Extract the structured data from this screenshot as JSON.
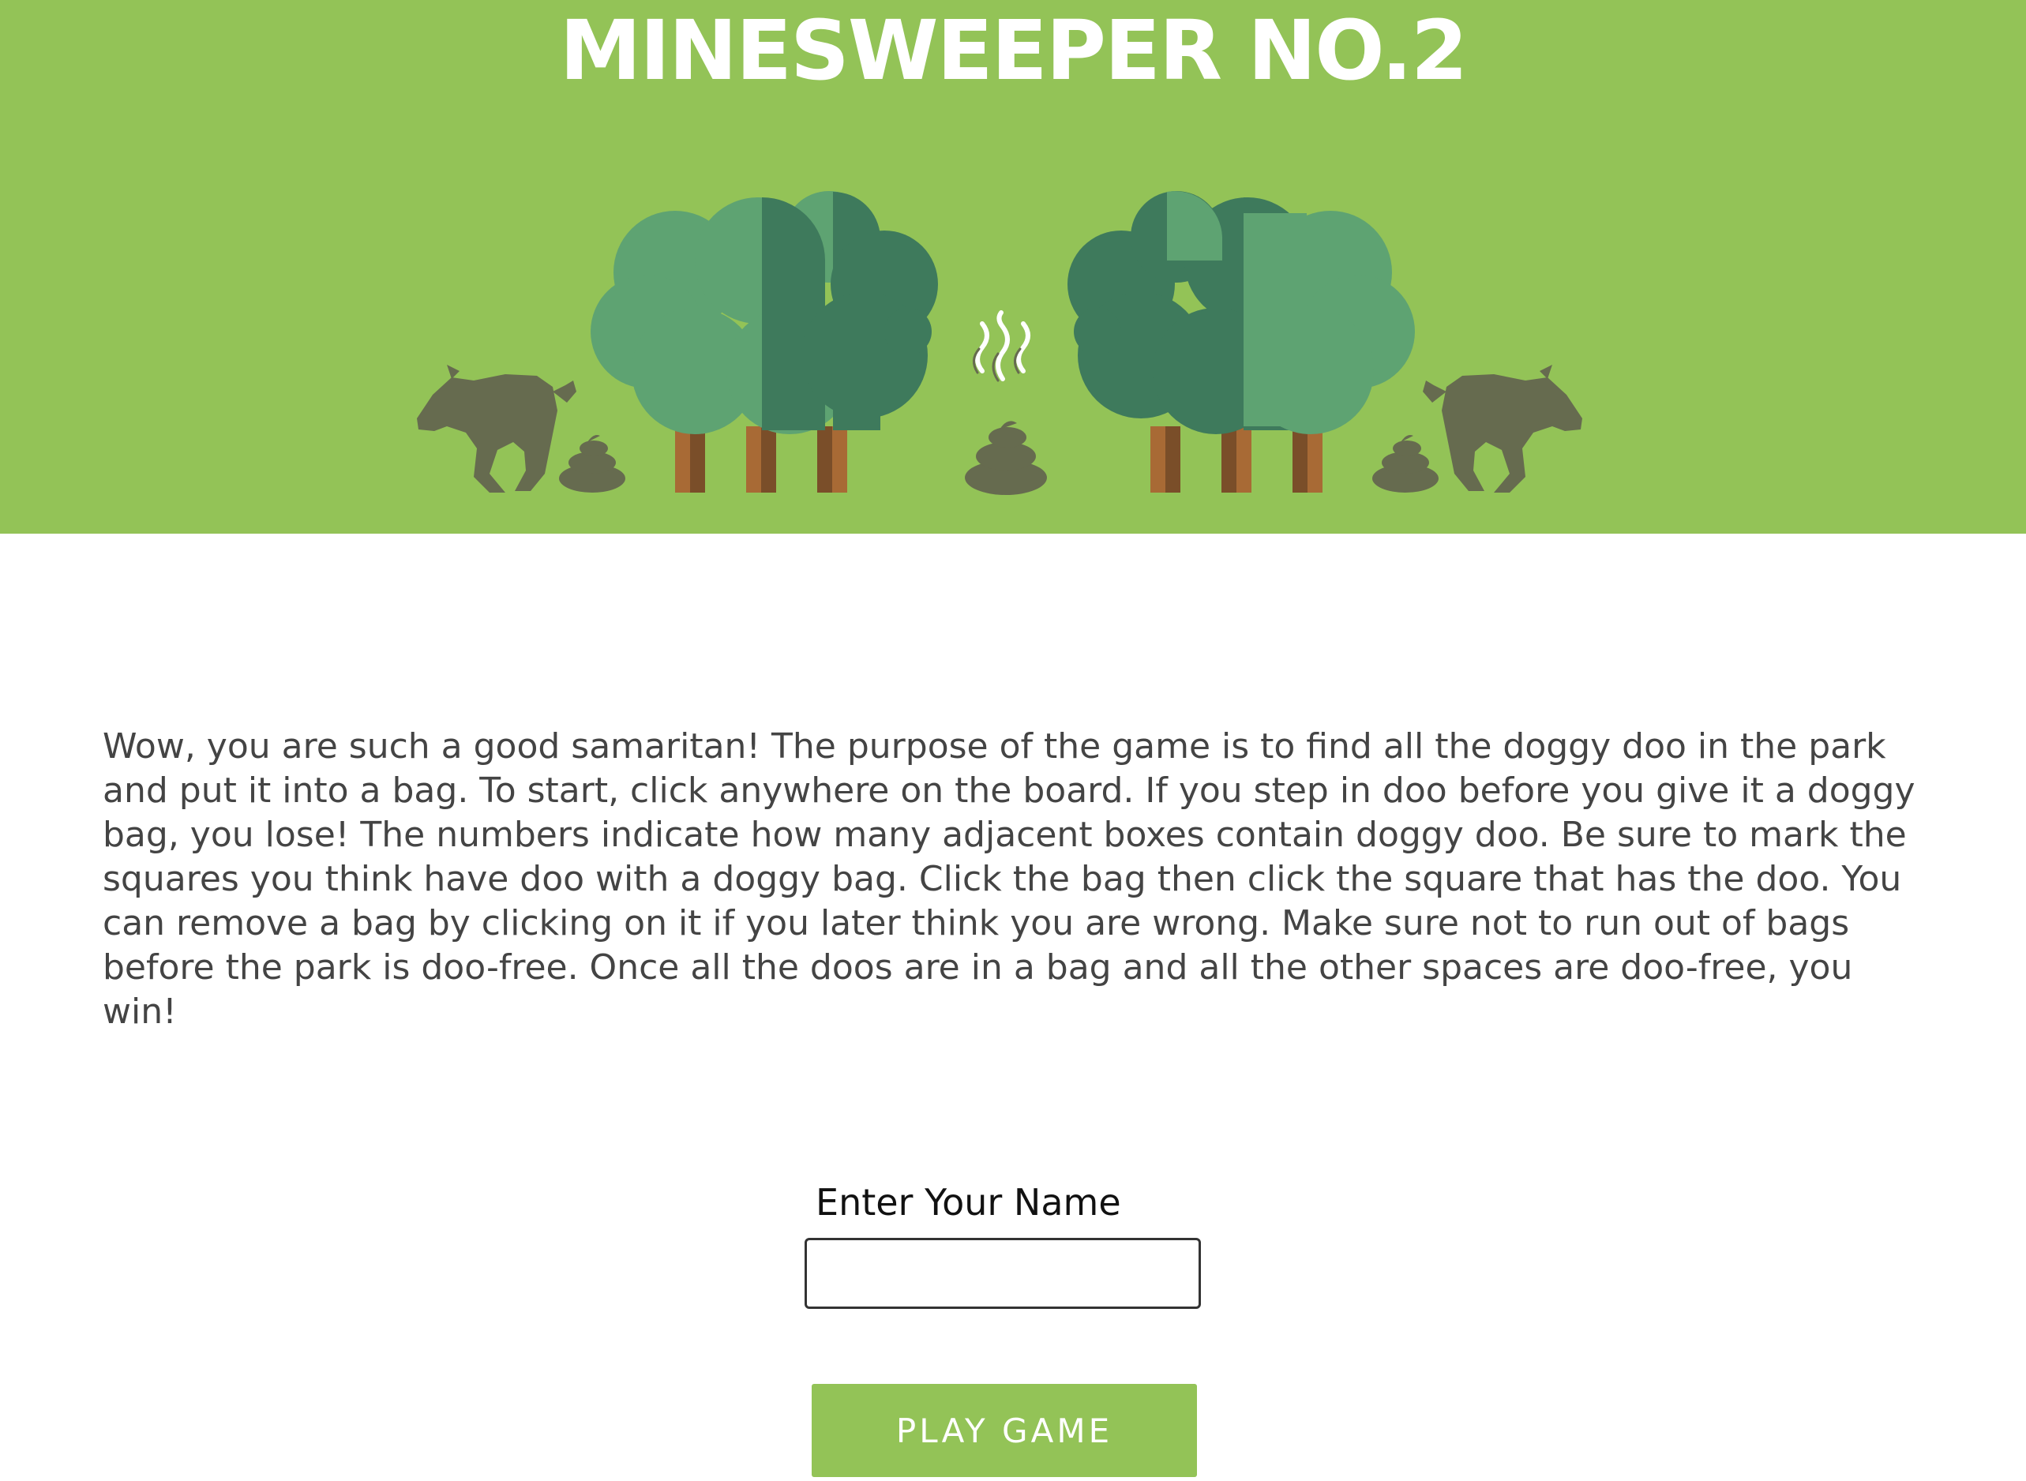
{
  "header": {
    "title": "MINESWEEPER NO.2"
  },
  "intro": {
    "text": "Wow, you are such a good samaritan! The purpose of the game is to find all the doggy doo in the park and put it into a bag. To start, click anywhere on the board. If you step in doo before you give it a doggy bag, you lose! The numbers indicate how many adjacent boxes contain doggy doo. Be sure to mark the squares you think have doo with a doggy bag. Click the bag then click the square that has the doo. You can remove a bag by clicking on it if you later think you are wrong. Make sure not to run out of bags before the park is doo-free. Once all the doos are in a bag and all the other spaces are doo-free, you win!"
  },
  "form": {
    "name_label": "Enter Your Name",
    "name_value": "",
    "play_label": "PLAY GAME"
  },
  "colors": {
    "banner": "#93c357",
    "tree_light": "#5ea372",
    "tree_dark": "#3e7a5c",
    "trunk": "#a86a35",
    "trunk_dark": "#7a4e29",
    "dog": "#666b4f",
    "button": "#93c357"
  },
  "icons": [
    "dog-icon",
    "poop-icon",
    "tree-icon",
    "steam-icon"
  ]
}
